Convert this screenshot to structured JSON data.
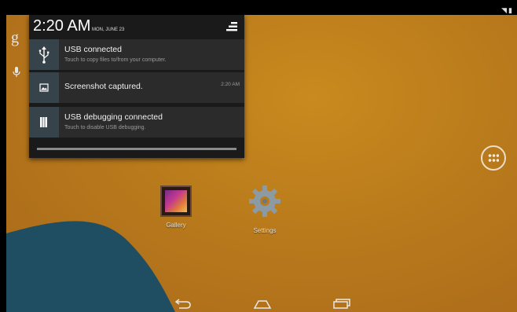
{
  "status_bar": {
    "icons": [
      "wifi-icon",
      "battery-icon"
    ]
  },
  "notification_panel": {
    "clock": "2:20 AM",
    "date": "MON, JUNE 23",
    "notifications": [
      {
        "icon": "usb-icon",
        "title": "USB connected",
        "subtitle": "Touch to copy files to/from your computer.",
        "time": ""
      },
      {
        "icon": "image-icon",
        "title": "Screenshot captured.",
        "subtitle": "",
        "time": "2:20 AM"
      },
      {
        "icon": "debug-icon",
        "title": "USB debugging connected",
        "subtitle": "Touch to disable USB debugging.",
        "time": ""
      }
    ]
  },
  "home": {
    "apps": [
      {
        "label": "Gallery"
      },
      {
        "label": "Settings"
      }
    ]
  },
  "colors": {
    "wallpaper": "#b97a1c",
    "wedge": "#1f4e63",
    "panel": "#1a1a1a",
    "notification": "#2b2b2b"
  }
}
